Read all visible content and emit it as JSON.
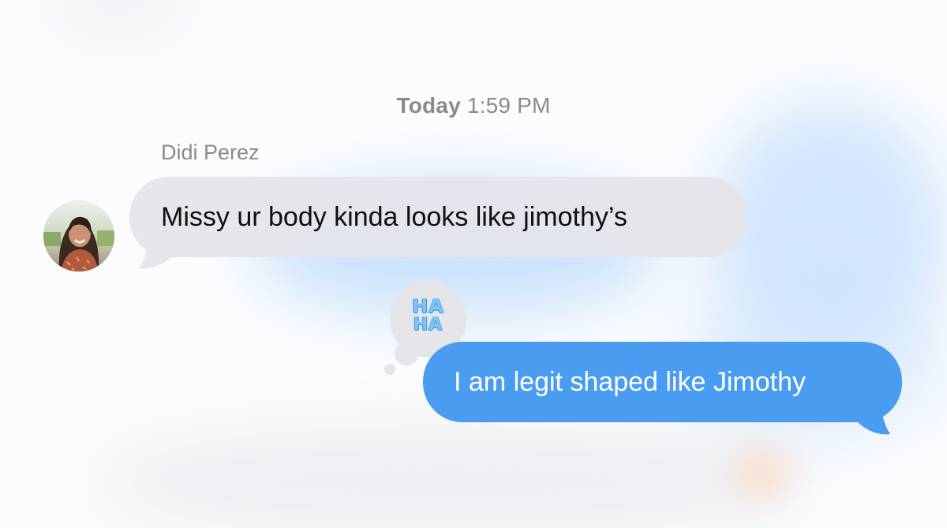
{
  "conversation": {
    "timestamp": {
      "day": "Today",
      "time": "1:59 PM"
    },
    "incoming": {
      "sender_name": "Didi Perez",
      "avatar": "contact-photo",
      "text": "Missy ur body kinda looks like jimothy’s"
    },
    "tapback": {
      "line1": "HA",
      "line2": "HA",
      "icon": "haha-reaction-icon"
    },
    "outgoing": {
      "text": "I am legit shaped like Jimothy"
    }
  },
  "colors": {
    "outgoing_bubble": "#4a9cf0",
    "incoming_bubble": "#e4e5eb",
    "meta_text": "#8a8a8e",
    "tapback_bubble": "#e5e6ea"
  }
}
